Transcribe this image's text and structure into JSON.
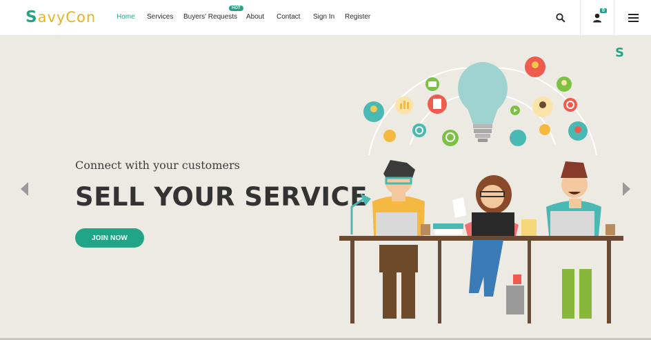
{
  "brand": {
    "logo_first": "S",
    "logo_rest": "avyCon"
  },
  "nav": {
    "items": [
      "Home",
      "Services",
      "Buyers' Requests",
      "About",
      "Contact",
      "Sign In",
      "Register"
    ],
    "hot_badge": "HOT"
  },
  "header_icons": {
    "search": "search-icon",
    "user": "user-icon",
    "cart_count": "0",
    "menu": "hamburger-icon"
  },
  "hero": {
    "subtitle": "Connect with your customers",
    "title": "SELL YOUR SERVICE",
    "cta": "JOIN NOW",
    "corner_mark": "S"
  },
  "colors": {
    "accent": "#21a586",
    "brand_yellow": "#e8b31d",
    "hero_bg": "#edeae4",
    "title": "#333333"
  }
}
